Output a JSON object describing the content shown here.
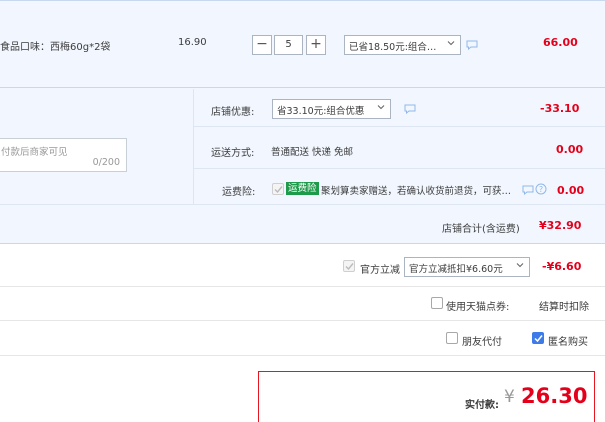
{
  "product": {
    "spec": "食品口味：西梅60g*2袋",
    "unit_price": "16.90",
    "quantity": "5",
    "qty_minus": "−",
    "qty_plus": "+",
    "promo_select": "已省18.50元:组合…",
    "subtotal": "66.00"
  },
  "store": {
    "discount_label": "店铺优惠:",
    "discount_select": "省33.10元:组合优惠",
    "discount_amount": "-33.10",
    "message_placeholder": "付款后商家可见",
    "message_counter": "0/200",
    "shipping_label": "运送方式:",
    "shipping_value": "普通配送 快递 免邮",
    "shipping_amount": "0.00",
    "insurance_label": "运费险:",
    "insurance_badge": "运费险",
    "insurance_text": "聚划算卖家赠送，若确认收货前退货，可获…",
    "insurance_amount": "0.00",
    "total_label": "店铺合计(含运费)",
    "total_amount": "¥32.90"
  },
  "official": {
    "label": "官方立减",
    "select": "官方立减抵扣¥6.60元",
    "amount": "-¥6.60"
  },
  "points": {
    "label": "使用天猫点券:",
    "note": "结算时扣除"
  },
  "options": {
    "friend_pay": "朋友代付",
    "anonymous": "匿名购买"
  },
  "payment": {
    "label": "实付款:",
    "currency": "¥",
    "amount": "26.30"
  },
  "colors": {
    "accent_red": "#e4001a",
    "panel_blue": "#f2f7ff",
    "check_blue": "#3d7be8",
    "badge_green": "#1d9a4a"
  }
}
